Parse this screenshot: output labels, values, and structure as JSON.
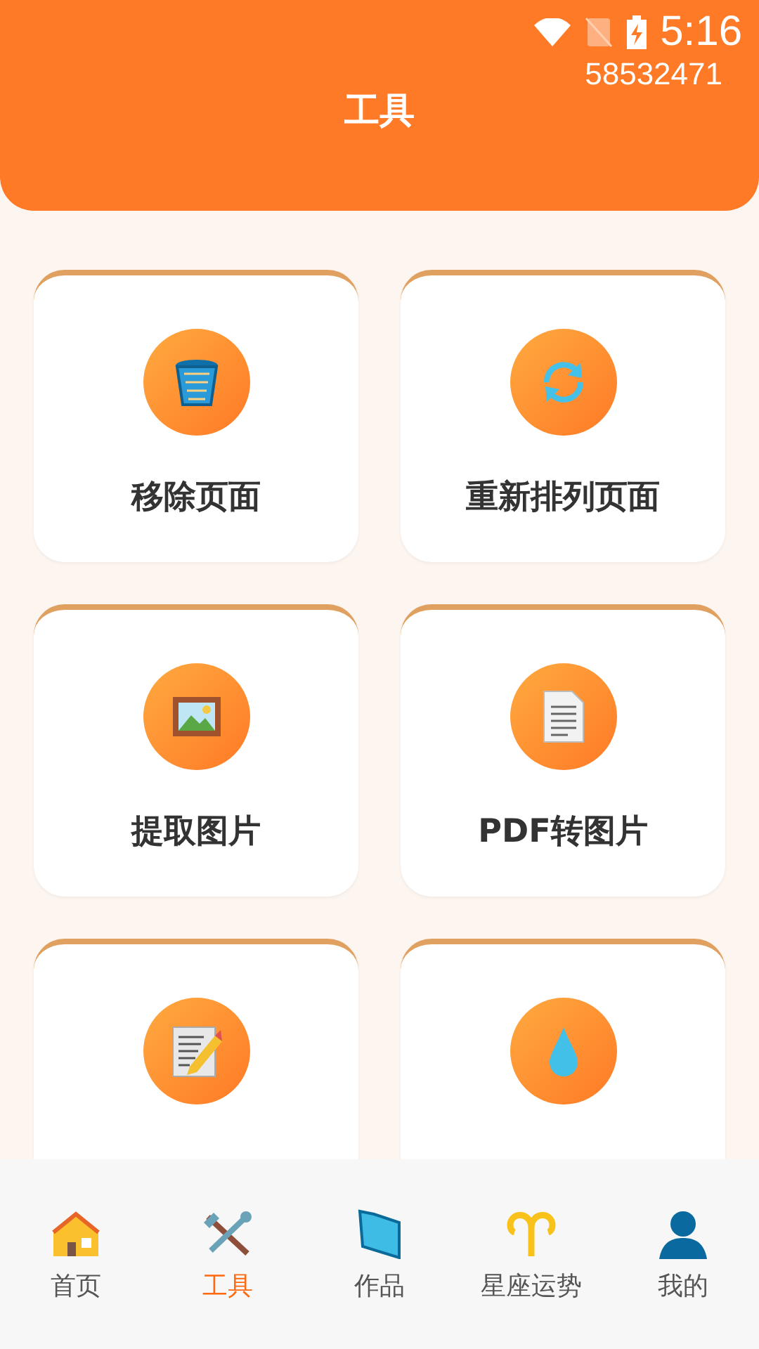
{
  "status_bar": {
    "time": "5:16"
  },
  "header": {
    "title": "工具",
    "code": "58532471"
  },
  "tools": [
    {
      "label": "移除页面",
      "kind": "trash"
    },
    {
      "label": "重新排列页面",
      "kind": "refresh"
    },
    {
      "label": "提取图片",
      "kind": "image"
    },
    {
      "label": "PDF转图片",
      "kind": "document"
    },
    {
      "kind": "memo"
    },
    {
      "kind": "drop"
    }
  ],
  "bottom_nav": [
    {
      "label": "首页",
      "kind": "house",
      "selected": false
    },
    {
      "label": "工具",
      "kind": "tools",
      "selected": true
    },
    {
      "label": "作品",
      "kind": "folder",
      "selected": false
    },
    {
      "label": "星座运势",
      "kind": "aries",
      "selected": false
    },
    {
      "label": "我的",
      "kind": "person",
      "selected": false
    }
  ]
}
